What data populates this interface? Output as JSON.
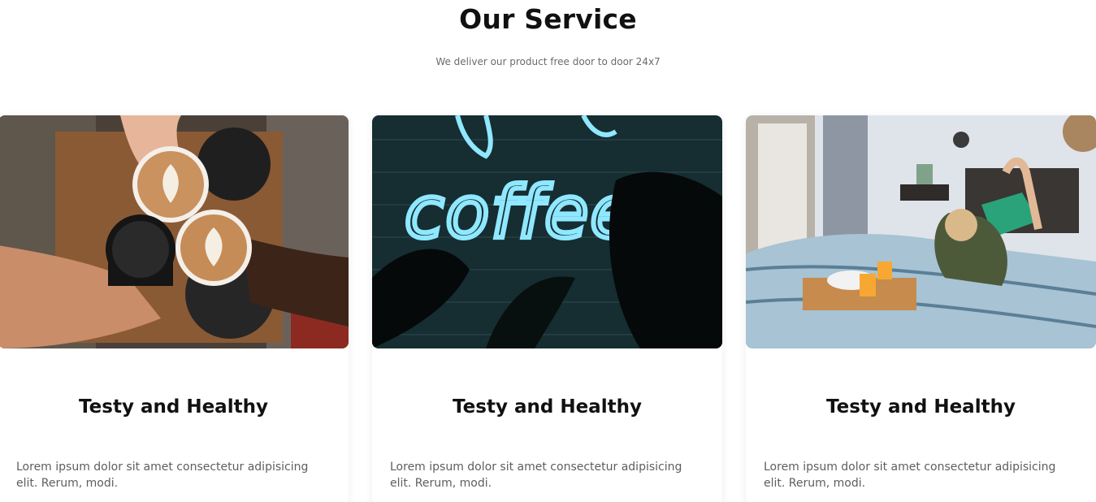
{
  "section": {
    "title": "Our Service",
    "subtitle": "We deliver our product free door to door 24x7"
  },
  "cards": [
    {
      "image": "coffee-cheers-photo",
      "title": "Testy and Healthy",
      "text": "Lorem ipsum dolor sit amet consectetur adipisicing elit. Rerum, modi."
    },
    {
      "image": "neon-coffee-sign-photo",
      "neon_text": "coffee",
      "title": "Testy and Healthy",
      "text": "Lorem ipsum dolor sit amet consectetur adipisicing elit. Rerum, modi."
    },
    {
      "image": "breakfast-in-bed-photo",
      "title": "Testy and Healthy",
      "text": "Lorem ipsum dolor sit amet consectetur adipisicing elit. Rerum, modi."
    }
  ],
  "colors": {
    "heading": "#111111",
    "body_text": "#5e5e5e",
    "neon": "#8fe8ff"
  }
}
